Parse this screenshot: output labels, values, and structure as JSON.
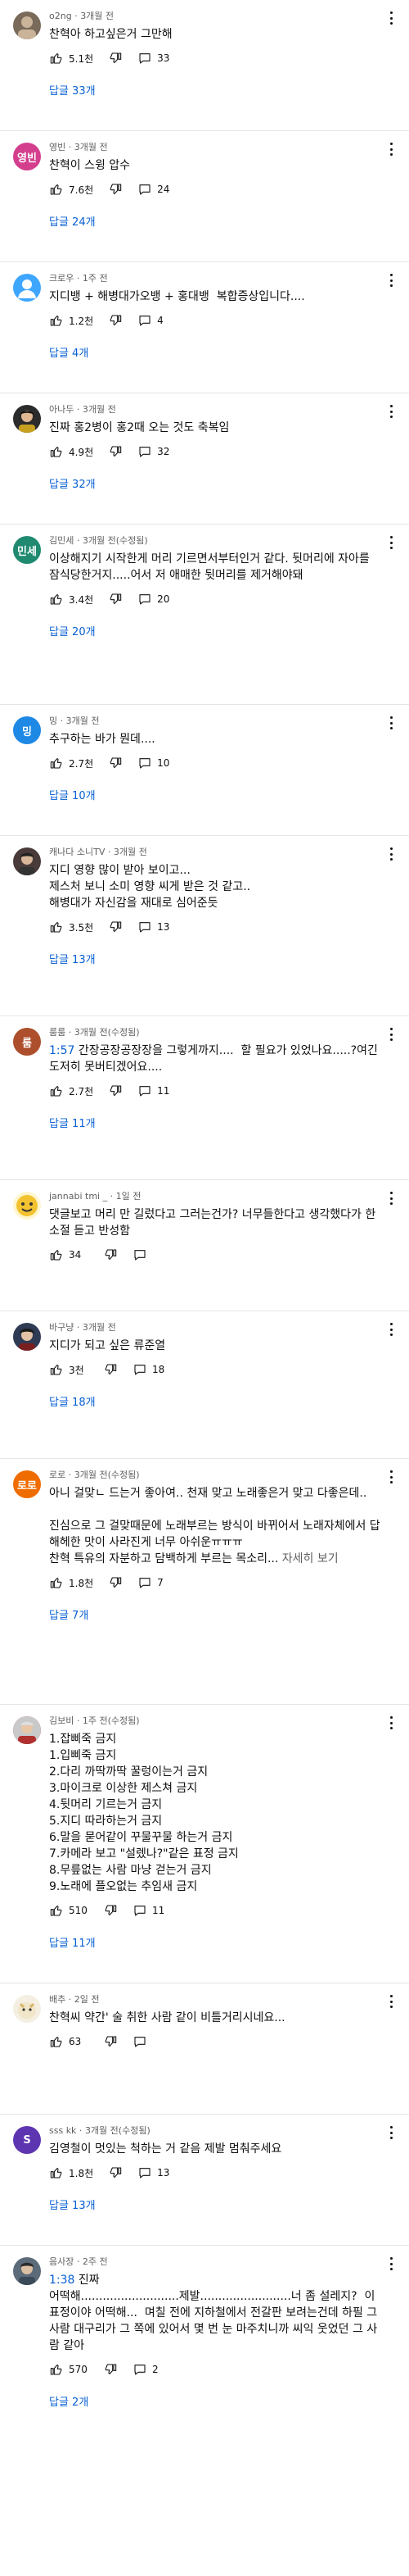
{
  "icons": {
    "like": "thumb-up-icon",
    "dislike": "thumb-down-icon",
    "reply": "reply-icon",
    "more": "more-vert-icon"
  },
  "colors": {
    "link": "#065fd4",
    "meta": "#606060",
    "text": "#0f0f0f"
  },
  "comments": [
    {
      "author": "o2ng",
      "time": "3개월 전",
      "avatar_text": "",
      "avatar_color": "#7a6a5a",
      "text": "찬혁아 하고싶은거 그만해",
      "likes": "5.1천",
      "replies_count": "33",
      "reply_label": "답글 33개"
    },
    {
      "author": "영빈",
      "time": "3개월 전",
      "avatar_text": "영빈",
      "avatar_color": "#d43f8d",
      "text": "찬혁이 스윙 압수",
      "likes": "7.6천",
      "replies_count": "24",
      "reply_label": "답글 24개"
    },
    {
      "author": "크로우",
      "time": "1주 전",
      "avatar_text": "",
      "avatar_color": "#3ea6ff",
      "text": "지디뱅 + 해병대가오뱅 + 홍대뱅  복합증상입니다....",
      "likes": "1.2천",
      "replies_count": "4",
      "reply_label": "답글 4개"
    },
    {
      "author": "아나두",
      "time": "3개월 전",
      "avatar_text": "",
      "avatar_color": "#2b2b2b",
      "text": "진짜 홍2병이 홍2때 오는 것도 축복임",
      "likes": "4.9천",
      "replies_count": "32",
      "reply_label": "답글 32개"
    },
    {
      "author": "김민세",
      "time": "3개월 전(수정됨)",
      "avatar_text": "민세",
      "avatar_color": "#1f8a70",
      "text": "이상해지기 시작한게 머리 기르면서부터인거 같다. 뒷머리에 자아를 잠식당한거지.....어서 저 애매한 뒷머리를 제거해야돼",
      "likes": "3.4천",
      "replies_count": "20",
      "reply_label": "답글 20개"
    },
    {
      "author": "밍",
      "time": "3개월 전",
      "avatar_text": "밍",
      "avatar_color": "#1e88e5",
      "text": "추구하는 바가 뭔데....",
      "likes": "2.7천",
      "replies_count": "10",
      "reply_label": "답글 10개"
    },
    {
      "author": "캐나다 소니TV",
      "time": "3개월 전",
      "avatar_text": "",
      "avatar_color": "#4a3b3b",
      "text": "지디 영향 많이 받아 보이고...\n제스처 보니 소미 영향 씨게 받은 것 같고..\n해병대가 자신감을 재대로 심어준듯",
      "likes": "3.5천",
      "replies_count": "13",
      "reply_label": "답글 13개"
    },
    {
      "author": "룸룸",
      "time": "3개월 전(수정됨)",
      "avatar_text": "룸",
      "avatar_color": "#ad4f2c",
      "timestamp": "1:57",
      "text": " 간장공장공장장을 그렇게까지....  할 필요가 있었나요.....?여긴 도저히 못버티겠어요....",
      "likes": "2.7천",
      "replies_count": "11",
      "reply_label": "답글 11개"
    },
    {
      "author": "jannabi tmi _",
      "time": "1일 전",
      "avatar_text": "",
      "avatar_color": "#f2c230",
      "text": "댓글보고 머리 만 길렀다고 그러는건가? 너무들한다고 생각했다가 한소절 듣고 반성함",
      "likes": "34",
      "replies_count": "",
      "reply_label": ""
    },
    {
      "author": "바구냥",
      "time": "3개월 전",
      "avatar_text": "",
      "avatar_color": "#2f3b55",
      "text": "지디가 되고 싶은 류준열",
      "likes": "3천",
      "replies_count": "18",
      "reply_label": "답글 18개"
    },
    {
      "author": "로로",
      "time": "3개월 전(수정됨)",
      "avatar_text": "로로",
      "avatar_color": "#ef6c00",
      "text": "아니 걸맞ㄴ 드는거 좋아여.. 천재 맞고 노래좋은거 맞고 다좋은데..\n\n진심으로 그 걸맞때문에 노래부르는 방식이 바뀌어서 노래자체에서 답해헤한 맛이 사라진게 너무 아쉬운ㅠㅠㅠ\n찬혁 특유의 자분하고 담백하게 부르는 목소리...",
      "more": " 자세히 보기",
      "likes": "1.8천",
      "replies_count": "7",
      "reply_label": "답글 7개"
    },
    {
      "author": "김보비",
      "time": "1주 전(수정됨)",
      "avatar_text": "",
      "avatar_color": "#b03030",
      "text": "1.잡삐죽 금지\n1.입삐죽 금지\n2.다리 까딱까딱 꿀렁이는거 금지\n3.마이크로 이상한 제스쳐 금지\n4.뒷머리 기르는거 금지\n5.지디 따라하는거 금지\n6.말을 묻어같이 꾸물꾸물 하는거 금지\n7.카메라 보고 \"설렜나?\"같은 표정 금지\n8.무릎없는 사람 마냥 걷는거 금지\n9.노래에 플오없는 추임새 금지",
      "likes": "510",
      "replies_count": "11",
      "reply_label": "답글 11개"
    },
    {
      "author": "배추",
      "time": "2일 전",
      "avatar_text": "",
      "avatar_color": "#f1e6c8",
      "text": "찬혁씨 약간' 술 취한 사람 같이 비틀거리시네요...",
      "likes": "63",
      "replies_count": "",
      "reply_label": ""
    },
    {
      "author": "sss kk",
      "time": "3개월 전(수정됨)",
      "avatar_text": "S",
      "avatar_color": "#5e35b1",
      "text": "김영철이 멋있는 척하는 거 같음 제발 멈춰주세요",
      "likes": "1.8천",
      "replies_count": "13",
      "reply_label": "답글 13개"
    },
    {
      "author": "음사장",
      "time": "2주 전",
      "avatar_text": "",
      "avatar_color": "#5b6b7a",
      "timestamp": "1:38",
      "text": " 진짜\n어떡해...........................제발.........................너 좀 설레지?  이 표정이야 어떡해...  며칠 전에 지하철에서 전갈판 보려는건데 하필 그 사람 대구리가 그 쪽에 있어서 몇 번 눈 마주치니까 씨익 웃었던 그 사람 같아",
      "likes": "570",
      "replies_count": "2",
      "reply_label": "답글 2개"
    }
  ]
}
